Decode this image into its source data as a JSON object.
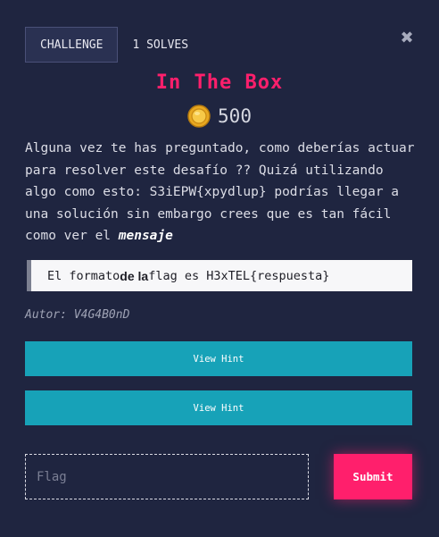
{
  "tabs": {
    "challenge": "CHALLENGE",
    "solves": "1 SOLVES"
  },
  "close_icon": "close-icon",
  "challenge": {
    "title": "In The Box",
    "points": "500",
    "points_icon": "coin-icon",
    "description_intro": "Alguna vez te has preguntado, como deberías actuar para resolver este desafío ?? Quizá utilizando algo como esto: S3iEPW{xpydlup} podrías llegar a una solución sin embargo crees que es tan fácil como ver el ",
    "description_emphasis": "mensaje",
    "quote_before": "El formato ",
    "quote_bold": "de la",
    "quote_after": " flag es H3xTEL{respuesta}",
    "author": "Autor: V4G4B0nD"
  },
  "hints": [
    {
      "label": "View Hint"
    },
    {
      "label": "View Hint"
    }
  ],
  "submission": {
    "flag_placeholder": "Flag",
    "submit_label": "Submit"
  },
  "colors": {
    "background": "#1f2540",
    "title": "#ff1f6c",
    "hint_button": "#17a2b8",
    "submit_button": "#ff1f6c"
  }
}
